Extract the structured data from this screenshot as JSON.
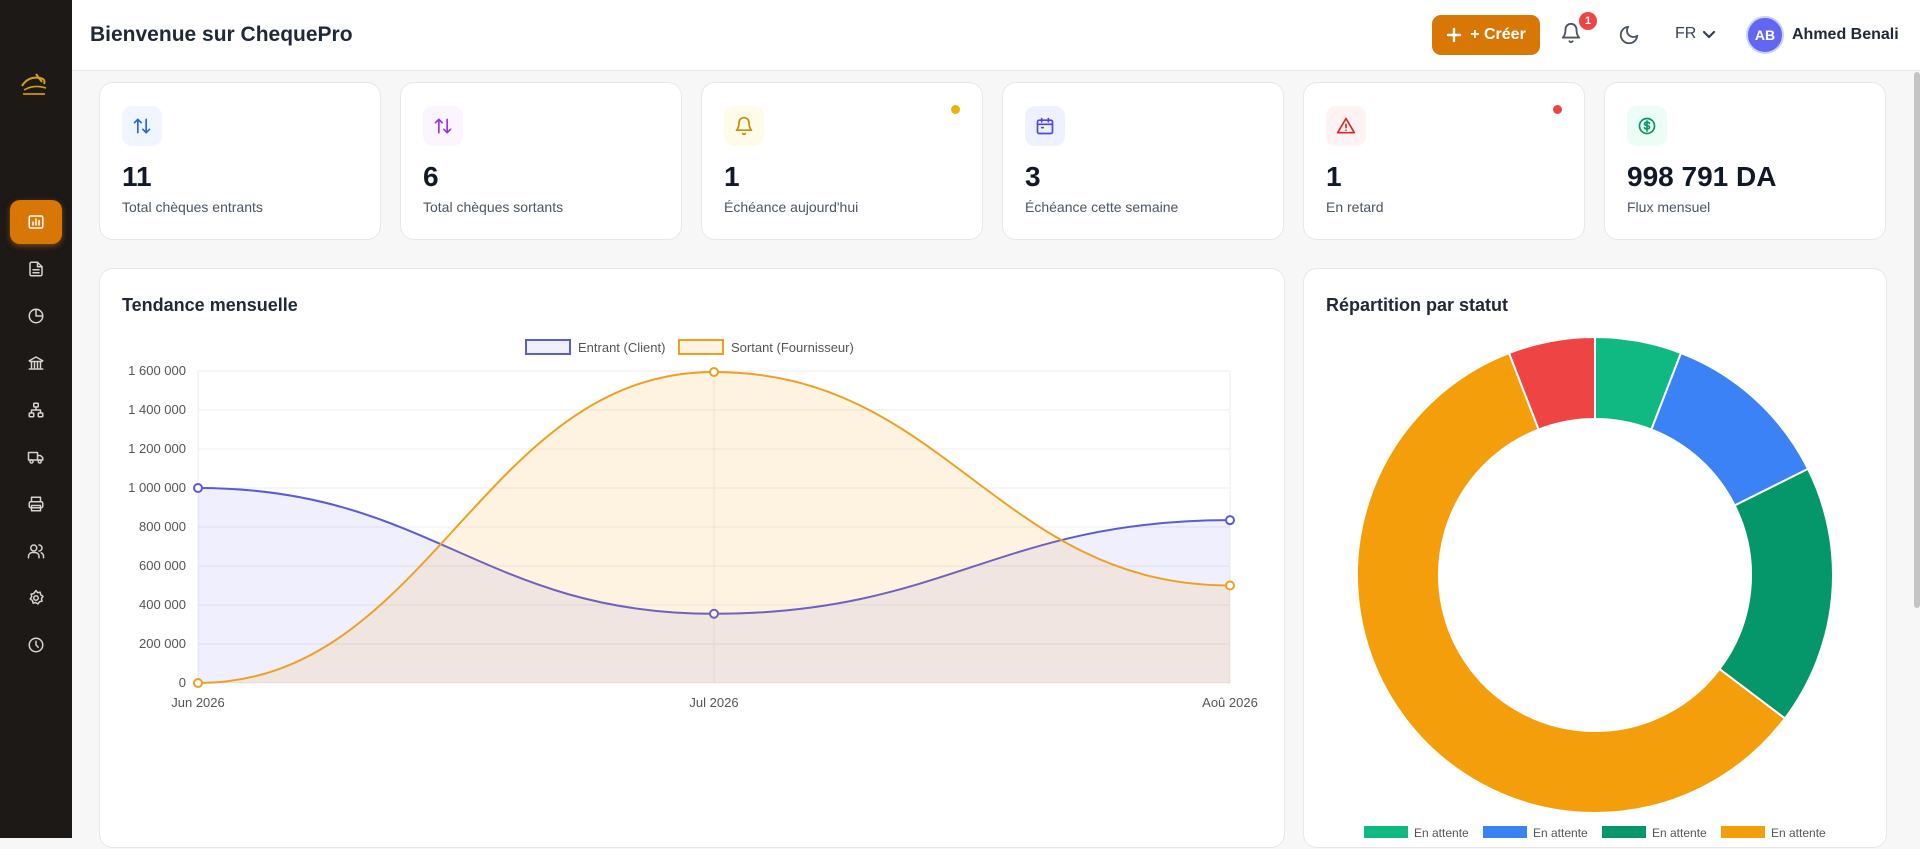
{
  "header": {
    "title": "Bienvenue sur ChequePro",
    "create_label": "+ Créer",
    "notification_count": "1",
    "language": "FR",
    "avatar_initials": "AB",
    "user_name": "Ahmed Benali"
  },
  "sidebar": {
    "items": [
      {
        "icon": "bar-chart-icon",
        "active": true
      },
      {
        "icon": "document-icon",
        "active": false
      },
      {
        "icon": "pie-chart-icon",
        "active": false
      },
      {
        "icon": "bank-icon",
        "active": false
      },
      {
        "icon": "org-chart-icon",
        "active": false
      },
      {
        "icon": "truck-icon",
        "active": false
      },
      {
        "icon": "printer-icon",
        "active": false
      },
      {
        "icon": "users-icon",
        "active": false
      },
      {
        "icon": "settings-icon",
        "active": false
      },
      {
        "icon": "clock-icon",
        "active": false
      }
    ]
  },
  "stats": [
    {
      "value": "11",
      "label": "Total chèques entrants",
      "icon": "arrows-up-down-icon",
      "color": "#2563eb",
      "bg": "#eff6ff"
    },
    {
      "value": "6",
      "label": "Total chèques sortants",
      "icon": "arrows-up-down-icon",
      "color": "#9333ea",
      "bg": "#faf5ff"
    },
    {
      "value": "1",
      "label": "Échéance aujourd'hui",
      "icon": "bell-icon",
      "color": "#ca8a04",
      "bg": "#fefce8",
      "dot": "#eab308"
    },
    {
      "value": "3",
      "label": "Échéance cette semaine",
      "icon": "calendar-icon",
      "color": "#4f46e5",
      "bg": "#eef2ff"
    },
    {
      "value": "1",
      "label": "En retard",
      "icon": "alert-triangle-icon",
      "color": "#dc2626",
      "bg": "#fef2f2",
      "dot": "#ef4444"
    },
    {
      "value": "998 791 DA",
      "label": "Flux mensuel",
      "icon": "dollar-circle-icon",
      "color": "#059669",
      "bg": "#ecfdf5"
    }
  ],
  "trend_title": "Tendance mensuelle",
  "status_title": "Répartition par statut",
  "chart_data": [
    {
      "type": "line",
      "title": "Tendance mensuelle",
      "categories": [
        "Jun 2026",
        "Jul 2026",
        "Aoû 2026"
      ],
      "series": [
        {
          "name": "Entrant (Client)",
          "values": [
            1000000,
            355000,
            835000
          ],
          "color": "#5b5bd6",
          "fill": "rgba(99,102,241,0.10)"
        },
        {
          "name": "Sortant (Fournisseur)",
          "values": [
            0,
            1595000,
            500000
          ],
          "color": "#f0a020",
          "fill": "rgba(245,158,11,0.12)"
        }
      ],
      "ylim": [
        0,
        1600000
      ],
      "yticks": [
        "0",
        "200 000",
        "400 000",
        "600 000",
        "800 000",
        "1 000 000",
        "1 200 000",
        "1 400 000",
        "1 600 000"
      ],
      "grid": true,
      "legend": "top-center"
    },
    {
      "type": "pie",
      "title": "Répartition par statut",
      "donut": true,
      "slices": [
        {
          "label": "En attente",
          "value": 1,
          "color": "#10b981"
        },
        {
          "label": "En attente",
          "value": 2,
          "color": "#3b82f6"
        },
        {
          "label": "En attente",
          "value": 3,
          "color": "#059669"
        },
        {
          "label": "En attente",
          "value": 10,
          "color": "#f59e0b"
        },
        {
          "label": "",
          "value": 1,
          "color": "#ef4444"
        }
      ],
      "legend": "bottom"
    }
  ]
}
